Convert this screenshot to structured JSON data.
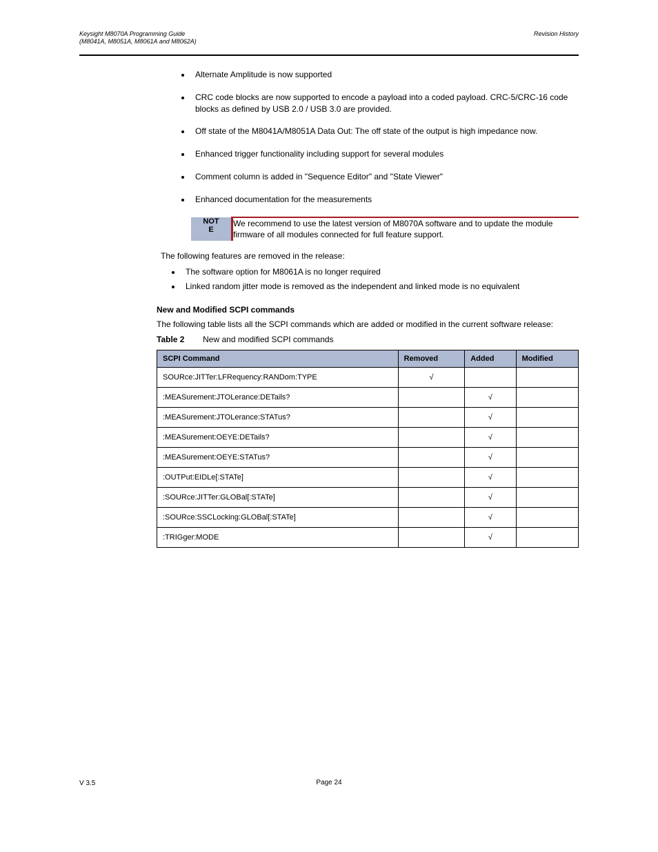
{
  "header": {
    "left_line1": "Keysight M8070A Programming Guide",
    "left_line2": "(M8041A, M8051A, M8061A and M8062A)",
    "right_line1": "Revision History",
    "right_line2": ""
  },
  "bullets": {
    "b1": "Alternate Amplitude is now supported",
    "b2": "CRC code blocks are now supported to encode a payload into a coded payload. CRC-5/CRC-16 code blocks as defined by USB 2.0 / USB 3.0 are provided.",
    "b3": "Off state of the M8041A/M8051A Data Out: The off state of the output is high impedance now.",
    "b4": "Enhanced trigger functionality including support for several modules",
    "b5": "Comment column is added in \"Sequence Editor\" and \"State Viewer\"",
    "b6": "Enhanced documentation for the measurements",
    "note": {
      "label1": "NOT",
      "label2": "E",
      "body": "We recommend to use the latest version of M8070A software and to update the module firmware of all modules connected for full feature support."
    },
    "removed_intro": "The following features are removed in the release:",
    "sub1": "The software option for M8061A is no longer required",
    "sub2": "Linked random jitter mode is removed as the independent and linked mode is no equivalent",
    "section_heading": "New and Modified SCPI commands",
    "para1": "The following table lists all the SCPI commands which are added or modified in the current software release:",
    "table_caption_label": "Table 2",
    "table_caption": "New and modified SCPI commands"
  },
  "table": {
    "headers": [
      "SCPI Command",
      "Removed",
      "Added",
      "Modified"
    ],
    "rows": [
      {
        "cmd": "SOURce:JITTer:LFRequency:RANDom:TYPE",
        "removed": "√",
        "added": "",
        "modified": ""
      },
      {
        "cmd": ":MEASurement:JTOLerance:DETails?",
        "removed": "",
        "added": "√",
        "modified": ""
      },
      {
        "cmd": ":MEASurement:JTOLerance:STATus?",
        "removed": "",
        "added": "√",
        "modified": ""
      },
      {
        "cmd": ":MEASurement:OEYE:DETails?",
        "removed": "",
        "added": "√",
        "modified": ""
      },
      {
        "cmd": ":MEASurement:OEYE:STATus?",
        "removed": "",
        "added": "√",
        "modified": ""
      },
      {
        "cmd": ":OUTPut:EIDLe[:STATe]",
        "removed": "",
        "added": "√",
        "modified": ""
      },
      {
        "cmd": ":SOURce:JITTer:GLOBal[:STATe]",
        "removed": "",
        "added": "√",
        "modified": ""
      },
      {
        "cmd": ":SOURce:SSCLocking:GLOBal[:STATe]",
        "removed": "",
        "added": "√",
        "modified": ""
      },
      {
        "cmd": ":TRIGger:MODE",
        "removed": "",
        "added": "√",
        "modified": ""
      }
    ]
  },
  "footer": {
    "version": "V 3.5",
    "page": "Page 24"
  }
}
